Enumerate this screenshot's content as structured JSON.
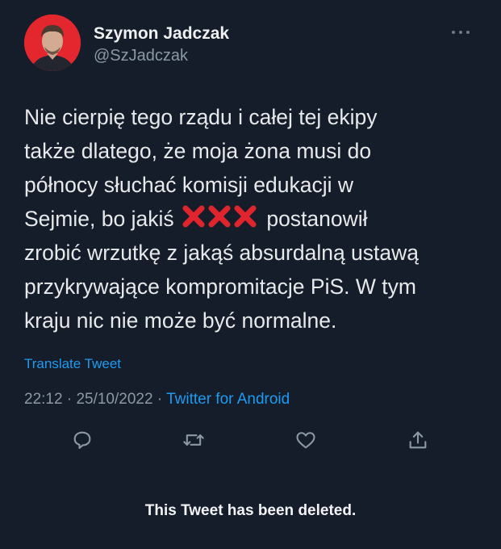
{
  "author": {
    "name": "Szymon Jadczak",
    "handle": "@SzJadczak"
  },
  "tweet": {
    "line1": "Nie cierpię tego rządu i całej tej ekipy",
    "line2": "także dlatego, że moja żona musi do",
    "line3": "północy słuchać komisji edukacji w",
    "line4_before": "Sejmie, bo jakiś",
    "line4_after": "postanowił",
    "line5": "zrobić wrzutkę z jakąś absurdalną ustawą",
    "line6": "przykrywające kompromitacje PiS. W tym",
    "line7": "kraju nic nie może być normalne.",
    "censor_icon": "cross-mark-emoji x3"
  },
  "translate_label": "Translate Tweet",
  "meta": {
    "time": "22:12",
    "separator": "·",
    "date": "25/10/2022",
    "source": "Twitter for Android"
  },
  "actions": [
    "reply-icon",
    "retweet-icon",
    "like-icon",
    "share-icon"
  ],
  "status_message": "This Tweet has been deleted.",
  "colors": {
    "background": "#151d2a",
    "link": "#1d9bf0",
    "muted": "#8b98a5",
    "emoji_red": "#e0242d",
    "avatar_bg": "#e4262f"
  }
}
